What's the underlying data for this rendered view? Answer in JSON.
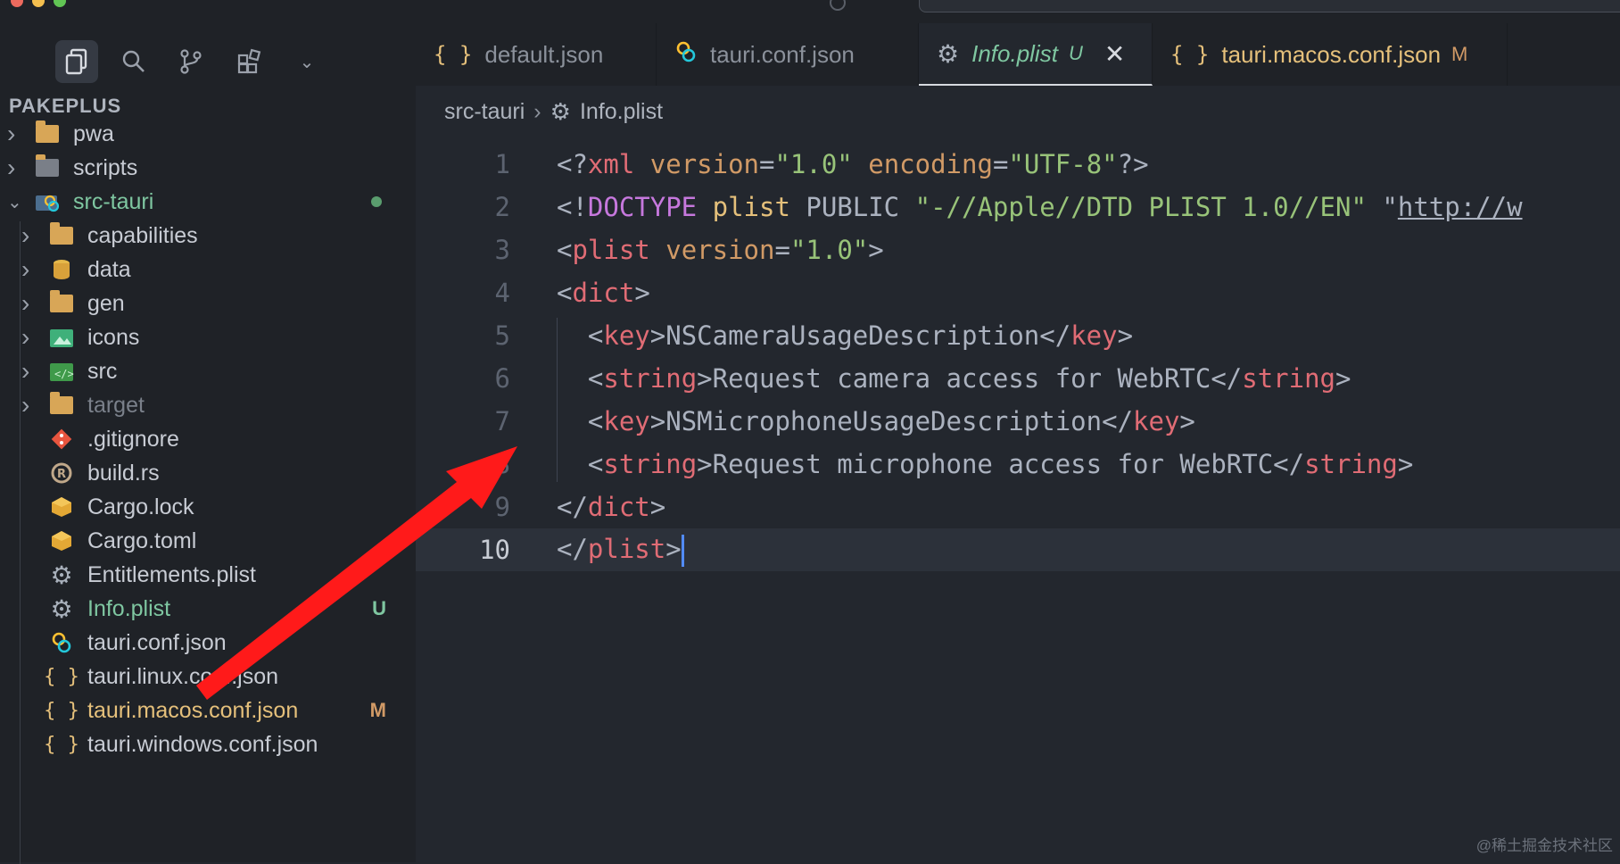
{
  "sidebar": {
    "title": "PAKEPLUS",
    "items": [
      {
        "label": "pwa",
        "icon": "folder-icon",
        "indent": 0,
        "chevron": true
      },
      {
        "label": "scripts",
        "icon": "scripts-folder-icon",
        "indent": 0,
        "chevron": true
      },
      {
        "label": "src-tauri",
        "icon": "tauri-folder-icon",
        "indent": 0,
        "chevron": true,
        "expanded": true,
        "modified_dot": true
      },
      {
        "label": "capabilities",
        "icon": "folder-icon",
        "indent": 1,
        "chevron": true
      },
      {
        "label": "data",
        "icon": "database-folder-icon",
        "indent": 1,
        "chevron": true
      },
      {
        "label": "gen",
        "icon": "folder-icon",
        "indent": 1,
        "chevron": true
      },
      {
        "label": "icons",
        "icon": "images-folder-icon",
        "indent": 1,
        "chevron": true
      },
      {
        "label": "src",
        "icon": "source-folder-icon",
        "indent": 1,
        "chevron": true
      },
      {
        "label": "target",
        "icon": "folder-icon",
        "indent": 1,
        "chevron": true,
        "dim": true
      },
      {
        "label": ".gitignore",
        "icon": "git-icon",
        "indent": 1
      },
      {
        "label": "build.rs",
        "icon": "rust-icon",
        "indent": 1
      },
      {
        "label": "Cargo.lock",
        "icon": "cargo-icon",
        "indent": 1
      },
      {
        "label": "Cargo.toml",
        "icon": "cargo-icon",
        "indent": 1
      },
      {
        "label": "Entitlements.plist",
        "icon": "gear-icon",
        "indent": 1
      },
      {
        "label": "Info.plist",
        "icon": "gear-icon",
        "indent": 1,
        "flag": "U"
      },
      {
        "label": "tauri.conf.json",
        "icon": "tauri-icon",
        "indent": 1
      },
      {
        "label": "tauri.linux.conf.json",
        "icon": "json-icon",
        "indent": 1
      },
      {
        "label": "tauri.macos.conf.json",
        "icon": "json-icon",
        "indent": 1,
        "flag": "M"
      },
      {
        "label": "tauri.windows.conf.json",
        "icon": "json-icon",
        "indent": 1
      }
    ]
  },
  "tabs": [
    {
      "label": "default.json",
      "icon": "{ }"
    },
    {
      "label": "tauri.conf.json",
      "icon": "tauri-icon"
    },
    {
      "label": "Info.plist",
      "icon": "gear-icon",
      "badge": "U",
      "close": "✕",
      "active": true
    },
    {
      "label": "tauri.macos.conf.json",
      "icon": "{ }",
      "badge": "M"
    }
  ],
  "breadcrumb": {
    "folder": "src-tauri",
    "sep": "›",
    "file": "Info.plist"
  },
  "code": {
    "line_numbers": [
      "1",
      "2",
      "3",
      "4",
      "5",
      "6",
      "7",
      "8",
      "9",
      "10"
    ],
    "lines": [
      "<?xml version=\"1.0\" encoding=\"UTF-8\"?>",
      "<!DOCTYPE plist PUBLIC \"-//Apple//DTD PLIST 1.0//EN\" \"http://w",
      "<plist version=\"1.0\">",
      "<dict>",
      "  <key>NSCameraUsageDescription</key>",
      "  <string>Request camera access for WebRTC</string>",
      "  <key>NSMicrophoneUsageDescription</key>",
      "  <string>Request microphone access for WebRTC</string>",
      "</dict>",
      "</plist>"
    ],
    "current_line": 10
  },
  "watermark": "@稀土掘金技术社区",
  "colors": {
    "accent_green": "#7fc7a1",
    "modified_yellow": "#e5c07b",
    "arrow_red": "#ff1a1a"
  }
}
